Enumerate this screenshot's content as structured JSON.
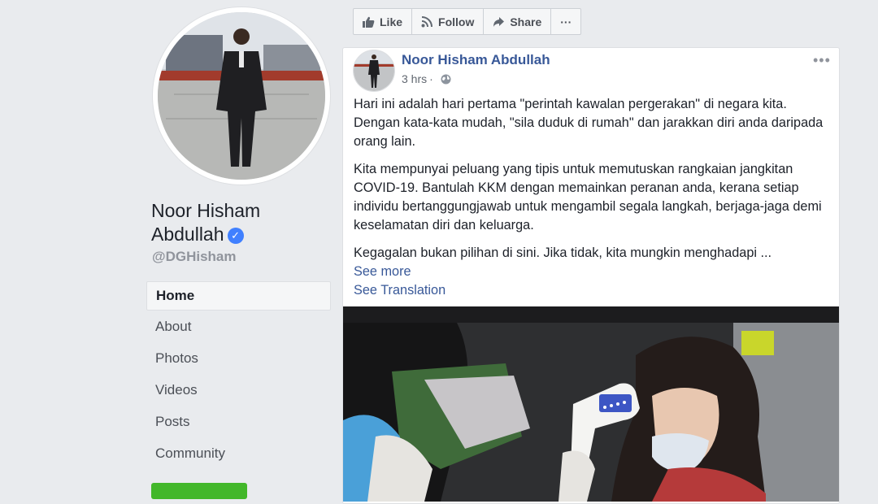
{
  "profile": {
    "name_line1": "Noor Hisham",
    "name_line2": "Abdullah",
    "handle": "@DGHisham"
  },
  "nav": {
    "items": [
      {
        "label": "Home"
      },
      {
        "label": "About"
      },
      {
        "label": "Photos"
      },
      {
        "label": "Videos"
      },
      {
        "label": "Posts"
      },
      {
        "label": "Community"
      }
    ]
  },
  "actions": {
    "like": "Like",
    "follow": "Follow",
    "share": "Share",
    "more": "···"
  },
  "post": {
    "author": "Noor Hisham Abdullah",
    "time": "3 hrs",
    "more": "•••",
    "paragraphs": [
      "Hari ini adalah hari pertama \"perintah kawalan pergerakan\" di negara kita. Dengan kata-kata mudah, \"sila duduk di rumah\" dan jarakkan diri anda daripada orang lain.",
      "Kita mempunyai peluang yang tipis untuk memutuskan rangkaian jangkitan COVID-19. Bantulah KKM dengan memainkan peranan anda, kerana setiap individu bertanggungjawab untuk mengambil segala langkah, berjaga-jaga demi keselamatan diri dan keluarga.",
      "Kegagalan bukan pilihan di sini. Jika tidak, kita mungkin menghadapi ..."
    ],
    "see_more": "See more",
    "see_translation": "See Translation"
  },
  "colors": {
    "background": "#e9ebee",
    "link": "#385898",
    "verified": "#4080ff",
    "cta_green": "#42b72a"
  }
}
